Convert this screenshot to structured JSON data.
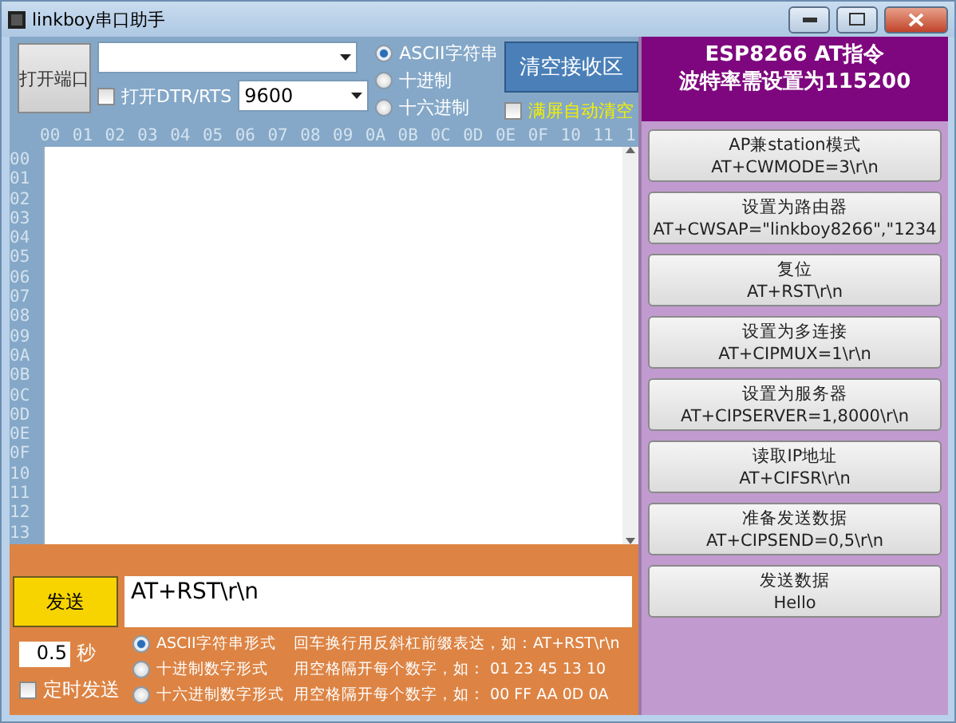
{
  "window": {
    "title": "linkboy串口助手"
  },
  "port": {
    "open_button": "打开端口",
    "dtr_rts": {
      "label": "打开DTR/RTS",
      "checked": false
    },
    "baud": "9600"
  },
  "receive_format": [
    {
      "label": "ASCII字符串",
      "selected": true
    },
    {
      "label": "十进制",
      "selected": false
    },
    {
      "label": "十六进制",
      "selected": false
    }
  ],
  "clear_button": "清空接收区",
  "auto_clear": {
    "label": "满屏自动清空",
    "checked": false
  },
  "hex_columns": [
    "00",
    "01",
    "02",
    "03",
    "04",
    "05",
    "06",
    "07",
    "08",
    "09",
    "0A",
    "0B",
    "0C",
    "0D",
    "0E",
    "0F",
    "10",
    "11",
    "1"
  ],
  "hex_rows": [
    "00",
    "01",
    "02",
    "03",
    "04",
    "05",
    "06",
    "07",
    "08",
    "09",
    "0A",
    "0B",
    "0C",
    "0D",
    "0E",
    "0F",
    "10",
    "11",
    "12",
    "13"
  ],
  "send": {
    "button": "发送",
    "value": "AT+RST\\r\\n",
    "interval": "0.5",
    "interval_unit": "秒",
    "timed": {
      "label": "定时发送",
      "checked": false
    }
  },
  "send_format": [
    {
      "label": "ASCII字符串形式",
      "hint": "回车换行用反斜杠前缀表达，如：AT+RST\\r\\n",
      "selected": true
    },
    {
      "label": "十进制数字形式",
      "hint": "用空格隔开每个数字，如： 01 23 45 13 10",
      "selected": false
    },
    {
      "label": "十六进制数字形式",
      "hint": "用空格隔开每个数字，如： 00 FF AA 0D 0A",
      "selected": false
    }
  ],
  "at_panel": {
    "title": [
      "ESP8266 AT指令",
      "波特率需设置为115200"
    ],
    "commands": [
      {
        "name": "AP兼station模式",
        "command": "AT+CWMODE=3\\r\\n"
      },
      {
        "name": "设置为路由器",
        "command": "AT+CWSAP=\"linkboy8266\",\"1234"
      },
      {
        "name": "复位",
        "command": "AT+RST\\r\\n"
      },
      {
        "name": "设置为多连接",
        "command": "AT+CIPMUX=1\\r\\n"
      },
      {
        "name": "设置为服务器",
        "command": "AT+CIPSERVER=1,8000\\r\\n"
      },
      {
        "name": "读取IP地址",
        "command": "AT+CIFSR\\r\\n"
      },
      {
        "name": "准备发送数据",
        "command": "AT+CIPSEND=0,5\\r\\n"
      },
      {
        "name": "发送数据",
        "command": "Hello"
      }
    ]
  }
}
